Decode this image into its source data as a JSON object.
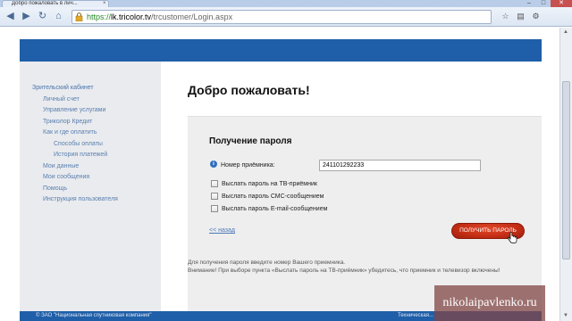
{
  "browser": {
    "tab_title": "Добро пожаловать в лич...",
    "tab_close": "×",
    "url_scheme": "https://",
    "url_host": "lk.tricolor.tv",
    "url_path": "/trcustomer/Login.aspx",
    "controls": {
      "minimize": "–",
      "maximize": "□",
      "close": "✕"
    },
    "nav": {
      "back": "◀",
      "forward": "▶",
      "reload": "↻",
      "home": "⌂"
    },
    "toolbar_icons": [
      "bookmark-star-icon",
      "page-icon",
      "tools-icon"
    ]
  },
  "sidebar": {
    "items": [
      {
        "label": "Зрительский кабинет",
        "level": 0
      },
      {
        "label": "Личный счет",
        "level": 1
      },
      {
        "label": "Управление услугами",
        "level": 1
      },
      {
        "label": "Триколор Кредит",
        "level": 1
      },
      {
        "label": "Как и где оплатить",
        "level": 1
      },
      {
        "label": "Способы оплаты",
        "level": 2
      },
      {
        "label": "История платежей",
        "level": 2
      },
      {
        "label": "Мои данные",
        "level": 1
      },
      {
        "label": "Мои сообщения",
        "level": 1
      },
      {
        "label": "Помощь",
        "level": 1
      },
      {
        "label": "Инструкция пользователя",
        "level": 1
      }
    ]
  },
  "main": {
    "title": "Добро пожаловать!",
    "form": {
      "heading": "Получение пароля",
      "receiver_label": "Номер приёмника:",
      "receiver_value": "241101292233",
      "options": [
        {
          "label": "Выслать пароль на ТВ-приёмник",
          "checked": false
        },
        {
          "label": "Выслать пароль СМС-сообщением",
          "checked": false
        },
        {
          "label": "Выслать пароль E-mail-сообщением",
          "checked": false
        }
      ],
      "back_link": "<< назад",
      "submit_label": "ПОЛУЧИТЬ ПАРОЛЬ"
    },
    "notes": [
      "Для получения пароля введите номер Вашего приемника.",
      "Внимание! При выборе пункта «Выслать пароль на ТВ-приёмник» убедитесь, что приемник и телевизор включены!"
    ]
  },
  "footer": {
    "copyright": "© ЗАО \"Национальная спутниковая компания\"",
    "support": "Техническая..."
  },
  "watermark": "nikolaipavlenko.ru",
  "colors": {
    "brand_blue": "#1f5ea8",
    "sidebar_bg": "#e9ebee",
    "link_blue": "#5a7fb0",
    "button_red": "#c22d14",
    "panel_bg": "#eeeeee"
  }
}
